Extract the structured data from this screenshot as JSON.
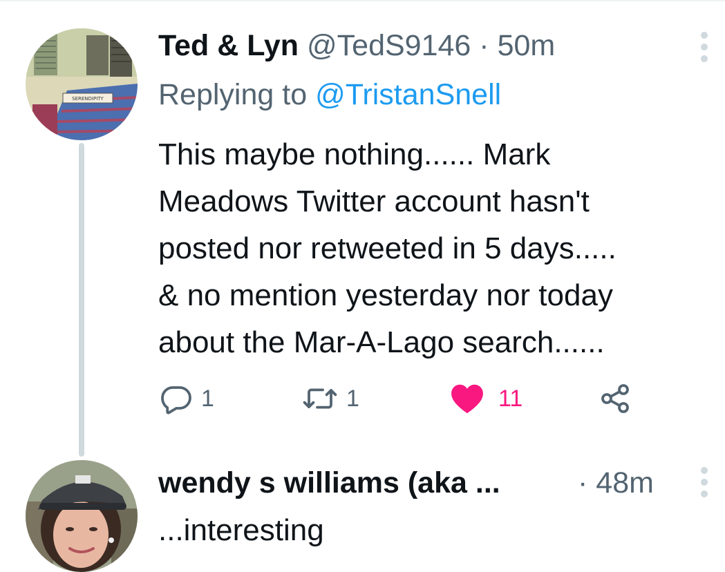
{
  "tweets": [
    {
      "display_name": "Ted & Lyn",
      "handle": "@TedS9146",
      "separator": "·",
      "time": "50m",
      "replying_prefix": "Replying to",
      "replying_to": "@TristanSnell",
      "avatar_sign_text": "SERENDIPITY",
      "body_lines": [
        "This maybe nothing...... Mark",
        "Meadows Twitter account hasn't",
        "posted nor retweeted in 5 days.....",
        "& no mention yesterday nor today",
        "about the Mar-A-Lago search......"
      ],
      "actions": {
        "reply_count": "1",
        "retweet_count": "1",
        "like_count": "11",
        "liked": true
      }
    },
    {
      "display_name": "wendy s williams (aka ...",
      "separator": "·",
      "time": "48m",
      "body": "...interesting"
    }
  ],
  "colors": {
    "text_primary": "#0f1419",
    "text_secondary": "#536471",
    "link": "#1d9bf0",
    "like": "#f91880",
    "thread_line": "#cfd9de"
  },
  "icons": {
    "reply": "speech-bubble-icon",
    "retweet": "retweet-arrows-icon",
    "like": "heart-icon",
    "share": "share-icon",
    "more": "vertical-dots-icon"
  }
}
